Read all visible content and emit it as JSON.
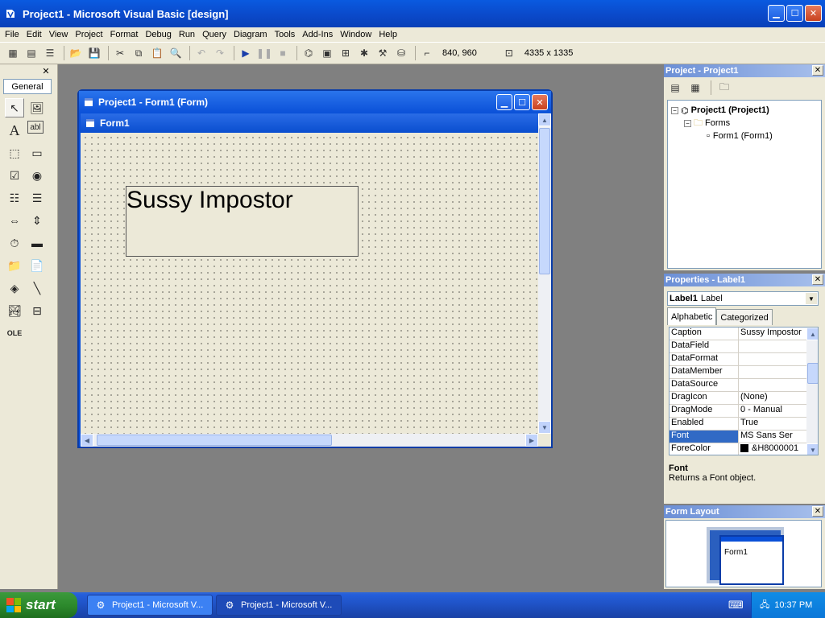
{
  "window": {
    "title": "Project1 - Microsoft Visual Basic [design]"
  },
  "menu": [
    "File",
    "Edit",
    "View",
    "Project",
    "Format",
    "Debug",
    "Run",
    "Query",
    "Diagram",
    "Tools",
    "Add-Ins",
    "Window",
    "Help"
  ],
  "toolbar": {
    "position": "840, 960",
    "size": "4335 x 1335"
  },
  "toolbox": {
    "tab_label": "General"
  },
  "form_window": {
    "title": "Project1 - Form1 (Form)",
    "form_caption": "Form1",
    "label_text": "Sussy Impostor"
  },
  "project_panel": {
    "title": "Project - Project1",
    "tree": {
      "root": "Project1 (Project1)",
      "folder": "Forms",
      "item": "Form1 (Form1)"
    }
  },
  "properties_panel": {
    "title": "Properties - Label1",
    "object_name": "Label1",
    "object_type": "Label",
    "tabs": [
      "Alphabetic",
      "Categorized"
    ],
    "rows": [
      {
        "name": "Caption",
        "value": "Sussy Impostor"
      },
      {
        "name": "DataField",
        "value": ""
      },
      {
        "name": "DataFormat",
        "value": ""
      },
      {
        "name": "DataMember",
        "value": ""
      },
      {
        "name": "DataSource",
        "value": ""
      },
      {
        "name": "DragIcon",
        "value": "(None)"
      },
      {
        "name": "DragMode",
        "value": "0 - Manual"
      },
      {
        "name": "Enabled",
        "value": "True"
      },
      {
        "name": "Font",
        "value": "MS Sans Ser"
      },
      {
        "name": "ForeColor",
        "value": "&H8000001"
      }
    ],
    "description_title": "Font",
    "description_text": "Returns a Font object."
  },
  "layout_panel": {
    "title": "Form Layout",
    "form_name": "Form1"
  },
  "taskbar": {
    "start_label": "start",
    "tasks": [
      "Project1 - Microsoft V...",
      "Project1 - Microsoft V..."
    ],
    "clock": "10:37 PM"
  },
  "colors": {
    "titlebar": "#0a50d8",
    "face": "#ece9d8",
    "mdi": "#808080",
    "start_green": "#2d8a2d"
  }
}
